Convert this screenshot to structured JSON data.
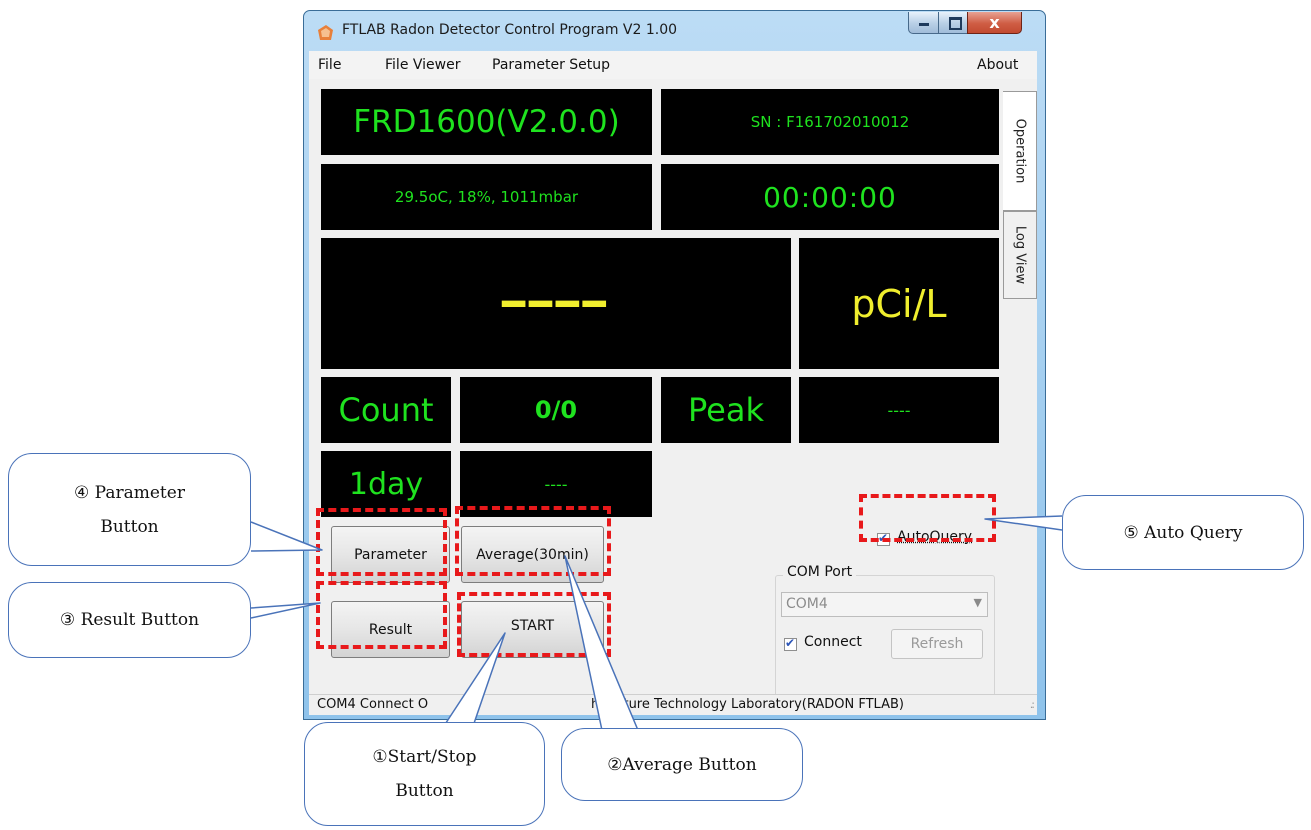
{
  "window": {
    "title": "FTLAB Radon Detector Control Program V2 1.00",
    "close_glyph": "x"
  },
  "menu": {
    "file": "File",
    "file_viewer": "File Viewer",
    "parameter_setup": "Parameter Setup",
    "about": "About"
  },
  "tabs": {
    "operation": "Operation",
    "log_view": "Log View"
  },
  "display": {
    "model": "FRD1600(V2.0.0)",
    "serial": "SN : F161702010012",
    "env": "29.5oC, 18%, 1011mbar",
    "timer": "00:00:00",
    "reading": "━━━━",
    "unit": "pCi/L",
    "count_label": "Count",
    "count_value": "0/0",
    "peak_label": "Peak",
    "peak_value": "----",
    "day_label": "1day",
    "day_value": "----"
  },
  "buttons": {
    "parameter": "Parameter",
    "average": "Average(30min)",
    "result": "Result",
    "start": "START"
  },
  "controls": {
    "autoquery_label": "AutoQuery",
    "autoquery_checked": true,
    "com_port_title": "COM Port",
    "com_port_value": "COM4",
    "connect_label": "Connect",
    "connect_checked": true,
    "refresh_label": "Refresh"
  },
  "status": {
    "left": "COM4 Connect O",
    "right": "ht Future Technology Laboratory(RADON FTLAB)"
  },
  "colors": {
    "display_green": "#1fe21f",
    "display_yellow": "#f0ee2e",
    "annotation_red": "#e8191b",
    "callout_blue": "#4a73b9"
  },
  "callouts": {
    "parameter_line1": "④ Parameter",
    "parameter_line2": "Button",
    "result": "③ Result Button",
    "auto_query": "⑤ Auto Query",
    "start_line1": "①Start/Stop",
    "start_line2": "Button",
    "average": "②Average Button"
  }
}
